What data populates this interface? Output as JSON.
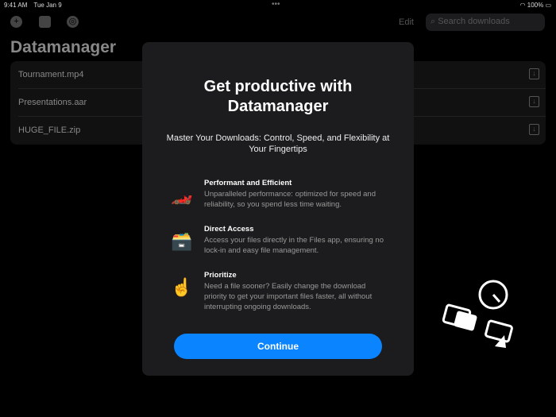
{
  "status": {
    "time": "9:41 AM",
    "date": "Tue Jan 9",
    "battery": "100%"
  },
  "toolbar": {
    "edit": "Edit",
    "search_placeholder": "Search downloads"
  },
  "page_title": "Datamanager",
  "files": [
    "Tournament.mp4",
    "Presentations.aar",
    "HUGE_FILE.zip"
  ],
  "modal": {
    "title": "Get productive with Datamanager",
    "subtitle": "Master Your Downloads: Control, Speed, and Flexibility at Your Fingertips",
    "features": [
      {
        "emoji": "🏎️",
        "title": "Performant and Efficient",
        "desc": "Unparalleled performance: optimized for speed and reliability, so you spend less time waiting."
      },
      {
        "emoji": "🗃️",
        "title": "Direct Access",
        "desc": "Access your files directly in the Files app, ensuring no lock-in and easy file management."
      },
      {
        "emoji": "☝️",
        "title": "Prioritize",
        "desc": "Need a file sooner? Easily change the download priority to get your important files faster, all without interrupting ongoing downloads."
      }
    ],
    "continue": "Continue"
  }
}
